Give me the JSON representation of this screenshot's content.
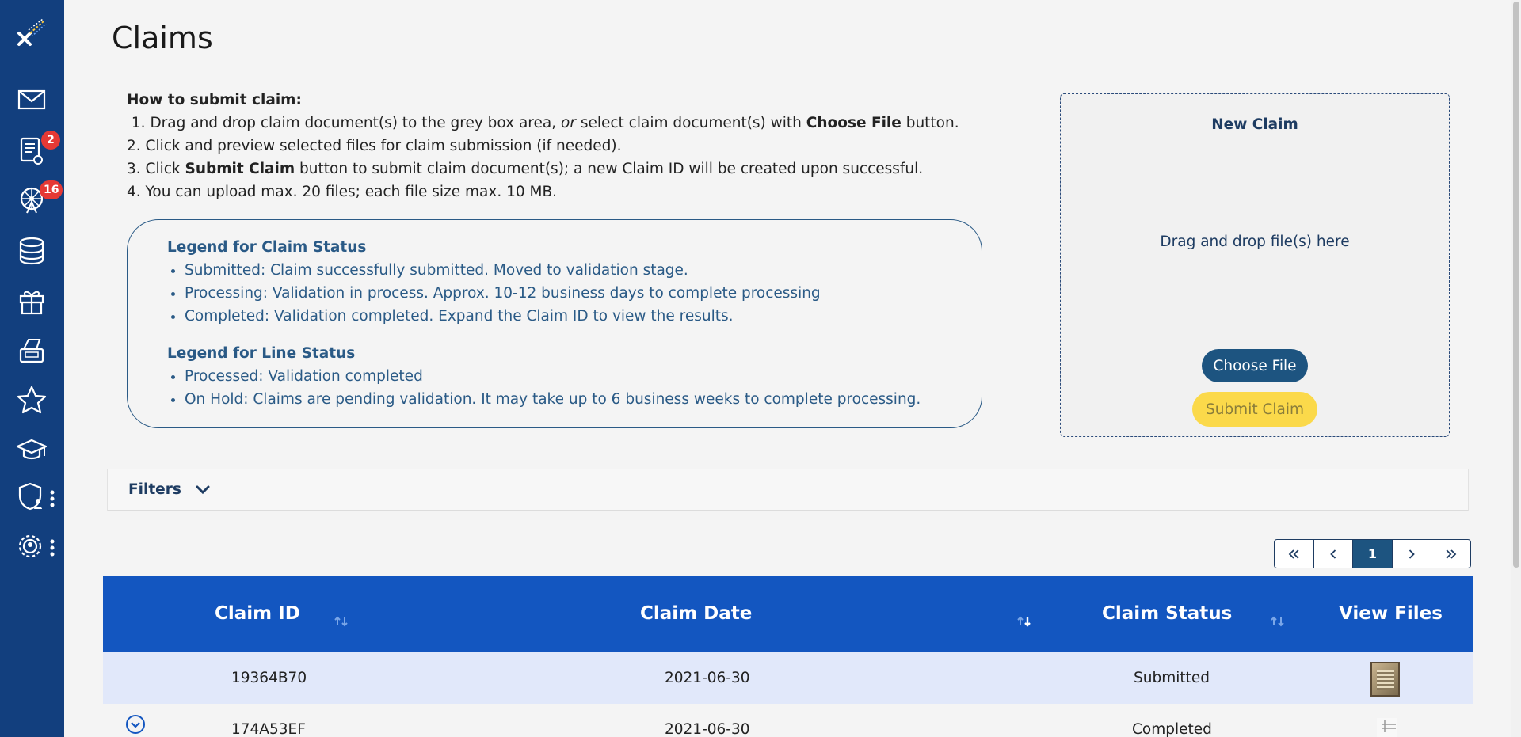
{
  "page": {
    "title": "Claims"
  },
  "sidebar": {
    "badges": {
      "documents": "2",
      "ferris_wheel": "16"
    }
  },
  "howto": {
    "heading": "How to submit claim:",
    "step1": {
      "num": "1.",
      "a": "Drag and drop claim document(s) to the grey box area, ",
      "or": "or",
      "b": " select claim document(s) with ",
      "bold": "Choose File",
      "c": " button."
    },
    "step2": "2. Click and preview selected files for claim submission (if needed).",
    "step3": {
      "num": "3. Click ",
      "bold": "Submit Claim",
      "rest": " button to submit claim document(s); a new Claim ID will be created upon successful."
    },
    "step4": "4. You can upload max. 20 files; each file size max. 10 MB."
  },
  "legend": {
    "claim_heading": "Legend for Claim Status",
    "claim_items": [
      "Submitted: Claim successfully submitted. Moved to validation stage.",
      "Processing: Validation in process. Approx. 10-12 business days to complete processing",
      "Completed: Validation completed. Expand the Claim ID to view the results."
    ],
    "line_heading": "Legend for Line Status",
    "line_items": [
      "Processed: Validation completed",
      "On Hold: Claims are pending validation. It may take up to 6 business weeks to complete processing."
    ]
  },
  "new_claim": {
    "title": "New Claim",
    "drop_text": "Drag and drop file(s) here",
    "choose_label": "Choose File",
    "submit_label": "Submit Claim"
  },
  "filters": {
    "label": "Filters"
  },
  "pager": {
    "first": "«",
    "prev": "‹",
    "current": "1",
    "next": "›",
    "last": "»"
  },
  "table": {
    "headers": [
      "Claim ID",
      "Claim Date",
      "Claim Status",
      "View Files"
    ],
    "rows": [
      {
        "id": "19364B70",
        "date": "2021-06-30",
        "status": "Submitted"
      },
      {
        "id": "174A53EF",
        "date": "2021-06-30",
        "status": "Completed"
      }
    ]
  },
  "colors": {
    "sidebar": "#123f7e",
    "table_header": "#1356c0",
    "accent": "#1d5480",
    "submit": "#fbd94a",
    "badge": "#e53935"
  }
}
